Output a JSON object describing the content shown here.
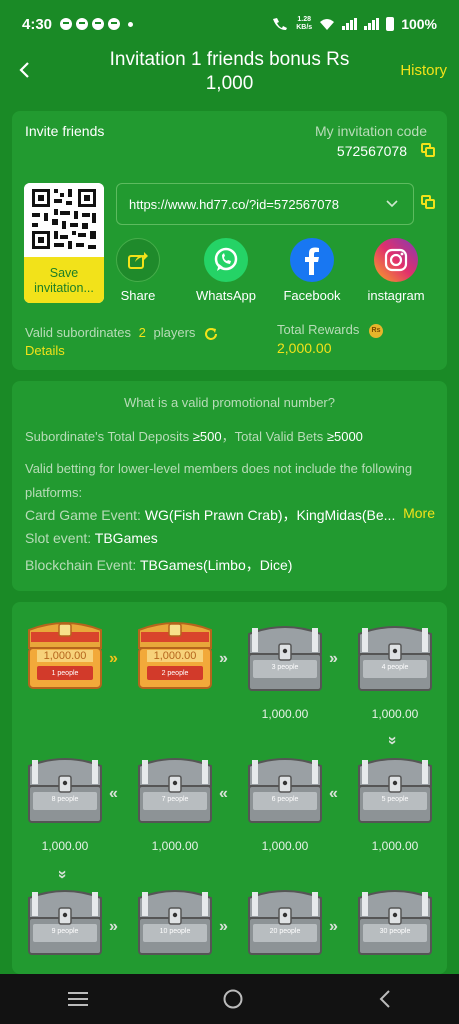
{
  "status": {
    "time": "4:30",
    "speed_top": "1.28",
    "speed_unit": "KB/s",
    "battery": "100%"
  },
  "header": {
    "title": "Invitation 1 friends bonus Rs 1,000",
    "history": "History"
  },
  "invite": {
    "title": "Invite friends",
    "code_label": "My invitation code",
    "code": "572567078",
    "save_label": "Save invitation...",
    "link": "https://www.hd77.co/?id=572567078",
    "share": [
      {
        "label": "Share",
        "icon": "share-icon"
      },
      {
        "label": "WhatsApp",
        "icon": "whatsapp-icon"
      },
      {
        "label": "Facebook",
        "icon": "facebook-icon"
      },
      {
        "label": "instagram",
        "icon": "instagram-icon"
      }
    ],
    "valid_label": "Valid subordinates",
    "valid_count": "2",
    "valid_unit": "players",
    "details": "Details",
    "rewards_label": "Total Rewards",
    "rewards_badge": "Rs",
    "rewards_value": "2,000.00"
  },
  "rules": {
    "question": "What is a valid promotional number?",
    "deposit_label": "Subordinate's Total Deposits",
    "deposit_value": "≥500",
    "bets_label": "Total Valid Bets",
    "bets_value": "≥5000",
    "note": "Valid betting for lower-level members does not include the following platforms:",
    "card_label": "Card Game Event:",
    "card_value": "WG(Fish Prawn Crab)，KingMidas(Be...",
    "more": "More",
    "slot_label": "Slot event:",
    "slot_value": "TBGames",
    "chain_label": "Blockchain Event:",
    "chain_value": "TBGames(Limbo，Dice)"
  },
  "chests": [
    {
      "people": "1 people",
      "amount": "1,000.00",
      "opened": true
    },
    {
      "people": "2 people",
      "amount": "1,000.00",
      "opened": true
    },
    {
      "people": "3 people",
      "amount": "1,000.00",
      "opened": false
    },
    {
      "people": "4 people",
      "amount": "1,000.00",
      "opened": false
    },
    {
      "people": "8 people",
      "amount": "1,000.00",
      "opened": false
    },
    {
      "people": "7 people",
      "amount": "1,000.00",
      "opened": false
    },
    {
      "people": "6 people",
      "amount": "1,000.00",
      "opened": false
    },
    {
      "people": "5 people",
      "amount": "1,000.00",
      "opened": false
    },
    {
      "people": "9 people",
      "amount": "",
      "opened": false
    },
    {
      "people": "10 people",
      "amount": "",
      "opened": false
    },
    {
      "people": "20 people",
      "amount": "",
      "opened": false
    },
    {
      "people": "30 people",
      "amount": "",
      "opened": false
    }
  ],
  "colors": {
    "background": "#1a8a26",
    "card": "#229a30",
    "accent": "#f2e21a"
  }
}
